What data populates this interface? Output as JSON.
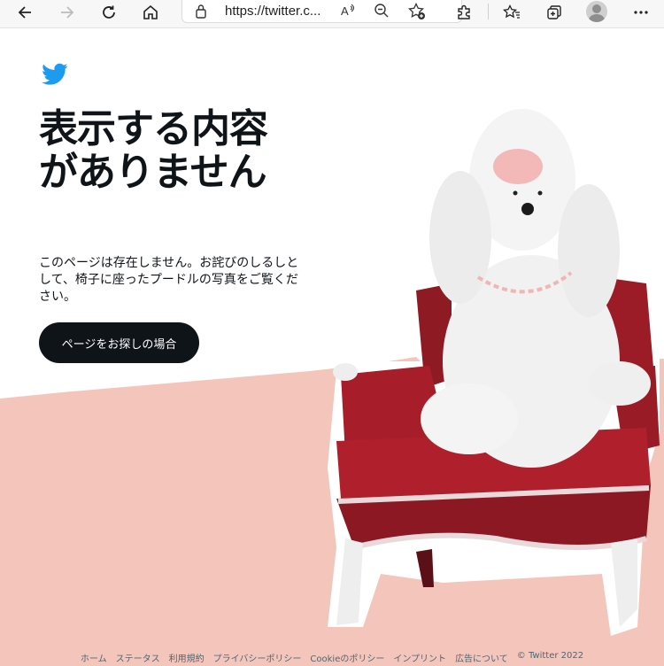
{
  "browser": {
    "url": "https://twitter.c...",
    "icons": {
      "back": "arrow-left-icon",
      "forward": "arrow-right-icon",
      "refresh": "refresh-icon",
      "home": "home-icon",
      "lock": "lock-icon",
      "read_aloud": "read-aloud-icon",
      "zoom": "zoom-out-icon",
      "favorite": "favorite-add-icon",
      "extensions": "puzzle-icon",
      "favorites": "favorites-star-icon",
      "collections": "collections-icon",
      "profile": "profile-avatar",
      "more": "ellipsis-icon"
    }
  },
  "page": {
    "headline": "表示する内容がありません",
    "description": "このページは存在しません。お詫びのしるしとして、椅子に座ったプードルの写真をご覧ください。",
    "search_button": "ページをお探しの場合",
    "colors": {
      "brand": "#1d9bf0",
      "background_pink": "#f4c6bb",
      "button": "#0f1419"
    }
  },
  "footer": {
    "links": [
      "ホーム",
      "ステータス",
      "利用規約",
      "プライバシーポリシー",
      "Cookieのポリシー",
      "インプリント",
      "広告について"
    ],
    "copyright": "© Twitter 2022"
  }
}
